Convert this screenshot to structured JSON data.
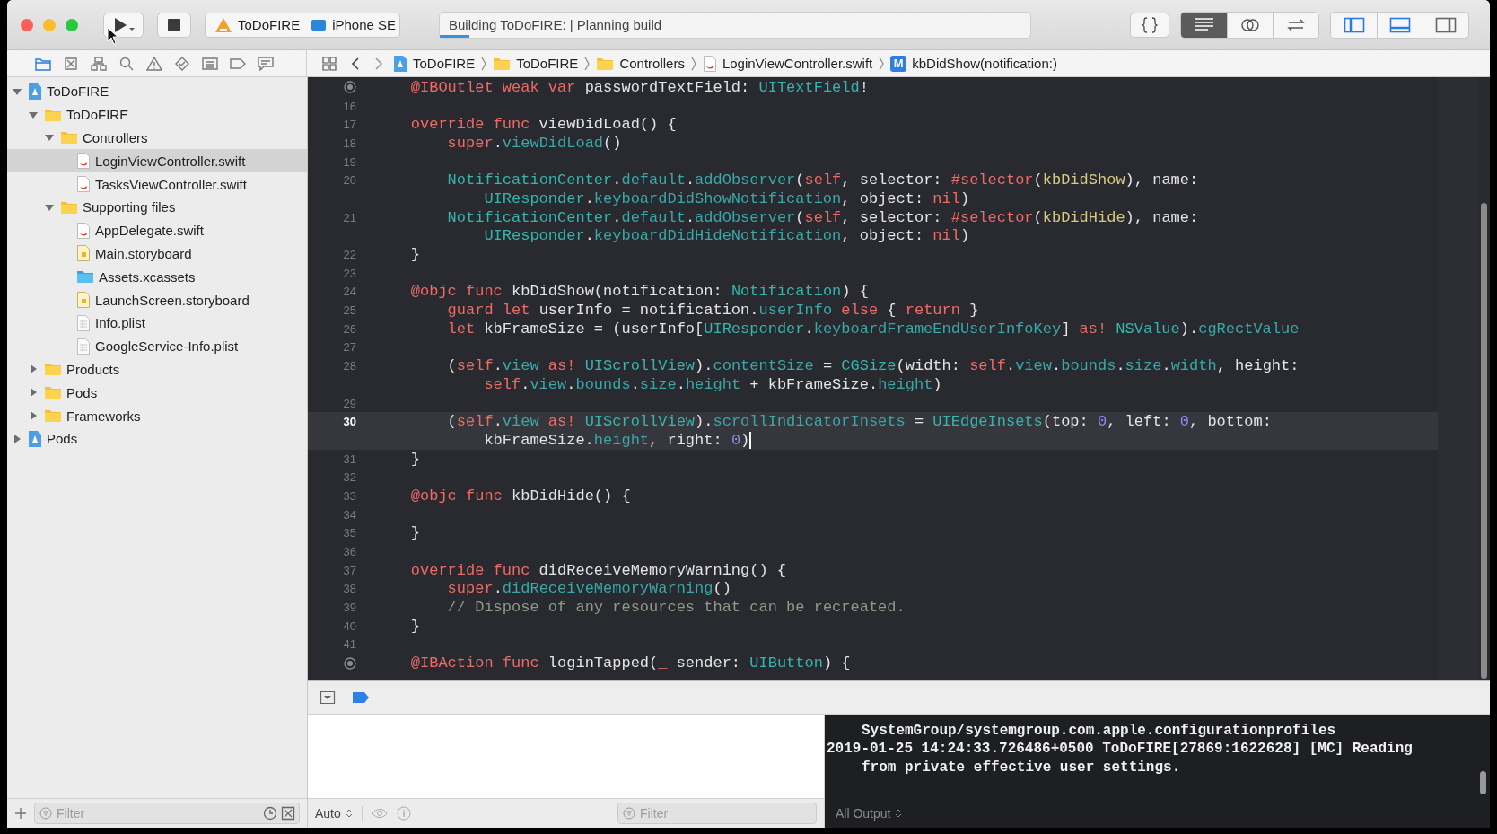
{
  "toolbar": {
    "scheme": "ToDoFIRE",
    "destination": "iPhone SE",
    "activity": {
      "text": "Building ToDoFIRE: | Planning build",
      "level": 0.05
    },
    "editor_modes": [
      {
        "kind": "standard",
        "selected": true
      },
      {
        "kind": "assistant",
        "selected": false
      },
      {
        "kind": "version",
        "selected": false
      }
    ],
    "panels": [
      {
        "kind": "navigator",
        "on": true
      },
      {
        "kind": "debug",
        "on": true
      },
      {
        "kind": "inspector",
        "on": false
      }
    ]
  },
  "navigator": {
    "tabs": [
      {
        "kind": "project",
        "selected": true
      },
      {
        "kind": "source-control",
        "selected": false
      },
      {
        "kind": "symbol",
        "selected": false
      },
      {
        "kind": "find",
        "selected": false
      },
      {
        "kind": "issue",
        "selected": false
      },
      {
        "kind": "test",
        "selected": false
      },
      {
        "kind": "debug",
        "selected": false
      },
      {
        "kind": "breakpoint",
        "selected": false
      },
      {
        "kind": "report",
        "selected": false
      }
    ],
    "tree": [
      {
        "label": "ToDoFIRE",
        "kind": "project",
        "expanded": true,
        "selected": false,
        "children": [
          {
            "label": "ToDoFIRE",
            "kind": "folder",
            "expanded": true,
            "selected": false,
            "children": [
              {
                "label": "Controllers",
                "kind": "folder",
                "expanded": true,
                "selected": false,
                "children": [
                  {
                    "label": "LoginViewController.swift",
                    "kind": "swift",
                    "selected": true
                  },
                  {
                    "label": "TasksViewController.swift",
                    "kind": "swift",
                    "selected": false
                  }
                ]
              },
              {
                "label": "Supporting files",
                "kind": "folder",
                "expanded": true,
                "selected": false,
                "children": [
                  {
                    "label": "AppDelegate.swift",
                    "kind": "swift",
                    "selected": false
                  },
                  {
                    "label": "Main.storyboard",
                    "kind": "storyboard",
                    "selected": false
                  },
                  {
                    "label": "Assets.xcassets",
                    "kind": "assets",
                    "selected": false
                  },
                  {
                    "label": "LaunchScreen.storyboard",
                    "kind": "storyboard",
                    "selected": false
                  },
                  {
                    "label": "Info.plist",
                    "kind": "plist",
                    "selected": false
                  },
                  {
                    "label": "GoogleService-Info.plist",
                    "kind": "plist",
                    "selected": false
                  }
                ]
              }
            ]
          },
          {
            "label": "Products",
            "kind": "folder",
            "expanded": false,
            "selected": false
          },
          {
            "label": "Pods",
            "kind": "folder",
            "expanded": false,
            "selected": false
          },
          {
            "label": "Frameworks",
            "kind": "folder",
            "expanded": false,
            "selected": false
          }
        ]
      },
      {
        "label": "Pods",
        "kind": "project",
        "expanded": false,
        "selected": false
      }
    ],
    "filter": {
      "placeholder": "Filter"
    }
  },
  "jump_bar": [
    {
      "kind": "project",
      "label": "ToDoFIRE"
    },
    {
      "kind": "folder",
      "label": "ToDoFIRE"
    },
    {
      "kind": "folder",
      "label": "Controllers"
    },
    {
      "kind": "swift",
      "label": "LoginViewController.swift"
    },
    {
      "badge": "M",
      "label": "kbDidShow(notification:)"
    }
  ],
  "editor": {
    "lines": [
      {
        "kind": "outlet",
        "current": false,
        "rows": [
          {
            "kind": "member",
            "tokens": [
              {
                "t": "@IBOutlet weak var",
                "kind": "kw"
              },
              {
                "t": " passwordTextField: ",
                "kind": "p"
              },
              {
                "t": "UITextField",
                "kind": "type"
              },
              {
                "t": "!",
                "kind": "p"
              }
            ]
          }
        ]
      },
      {
        "number": "16",
        "current": false
      },
      {
        "number": "17",
        "current": false,
        "rows": [
          {
            "kind": "member",
            "tokens": [
              {
                "t": "override func",
                "kind": "kw"
              },
              {
                "t": " viewDidLoad() {",
                "kind": "p"
              }
            ]
          }
        ]
      },
      {
        "number": "18",
        "current": false,
        "rows": [
          {
            "kind": "body",
            "tokens": [
              {
                "t": "super",
                "kind": "kw"
              },
              {
                "t": ".",
                "kind": "p"
              },
              {
                "t": "viewDidLoad",
                "kind": "mem"
              },
              {
                "t": "()",
                "kind": "p"
              }
            ]
          }
        ]
      },
      {
        "number": "19",
        "current": false
      },
      {
        "number": "20",
        "current": false,
        "rows": [
          {
            "kind": "body",
            "tokens": [
              {
                "t": "NotificationCenter",
                "kind": "type"
              },
              {
                "t": ".",
                "kind": "p"
              },
              {
                "t": "default",
                "kind": "mem"
              },
              {
                "t": ".",
                "kind": "p"
              },
              {
                "t": "addObserver",
                "kind": "mem"
              },
              {
                "t": "(",
                "kind": "p"
              },
              {
                "t": "self",
                "kind": "kw"
              },
              {
                "t": ", selector: ",
                "kind": "p"
              },
              {
                "t": "#selector",
                "kind": "kw"
              },
              {
                "t": "(",
                "kind": "p"
              },
              {
                "t": "kbDidShow",
                "kind": "sel"
              },
              {
                "t": "), name:",
                "kind": "p"
              }
            ]
          },
          {
            "kind": "wrap",
            "tokens": [
              {
                "t": "UIResponder",
                "kind": "type"
              },
              {
                "t": ".",
                "kind": "p"
              },
              {
                "t": "keyboardDidShowNotification",
                "kind": "mem"
              },
              {
                "t": ", object: ",
                "kind": "p"
              },
              {
                "t": "nil",
                "kind": "kw"
              },
              {
                "t": ")",
                "kind": "p"
              }
            ]
          }
        ]
      },
      {
        "number": "21",
        "current": false,
        "rows": [
          {
            "kind": "body",
            "tokens": [
              {
                "t": "NotificationCenter",
                "kind": "type"
              },
              {
                "t": ".",
                "kind": "p"
              },
              {
                "t": "default",
                "kind": "mem"
              },
              {
                "t": ".",
                "kind": "p"
              },
              {
                "t": "addObserver",
                "kind": "mem"
              },
              {
                "t": "(",
                "kind": "p"
              },
              {
                "t": "self",
                "kind": "kw"
              },
              {
                "t": ", selector: ",
                "kind": "p"
              },
              {
                "t": "#selector",
                "kind": "kw"
              },
              {
                "t": "(",
                "kind": "p"
              },
              {
                "t": "kbDidHide",
                "kind": "sel"
              },
              {
                "t": "), name:",
                "kind": "p"
              }
            ]
          },
          {
            "kind": "wrap",
            "tokens": [
              {
                "t": "UIResponder",
                "kind": "type"
              },
              {
                "t": ".",
                "kind": "p"
              },
              {
                "t": "keyboardDidHideNotification",
                "kind": "mem"
              },
              {
                "t": ", object: ",
                "kind": "p"
              },
              {
                "t": "nil",
                "kind": "kw"
              },
              {
                "t": ")",
                "kind": "p"
              }
            ]
          }
        ]
      },
      {
        "number": "22",
        "current": false,
        "rows": [
          {
            "kind": "member",
            "tokens": [
              {
                "t": "}",
                "kind": "p"
              }
            ]
          }
        ]
      },
      {
        "number": "23",
        "current": false
      },
      {
        "number": "24",
        "current": false,
        "rows": [
          {
            "kind": "member",
            "tokens": [
              {
                "t": "@objc func",
                "kind": "kw"
              },
              {
                "t": " kbDidShow(notification: ",
                "kind": "p"
              },
              {
                "t": "Notification",
                "kind": "type"
              },
              {
                "t": ") {",
                "kind": "p"
              }
            ]
          }
        ]
      },
      {
        "number": "25",
        "current": false,
        "rows": [
          {
            "kind": "body",
            "tokens": [
              {
                "t": "guard let",
                "kind": "kw"
              },
              {
                "t": " userInfo = notification.",
                "kind": "p"
              },
              {
                "t": "userInfo",
                "kind": "mem"
              },
              {
                "t": " else",
                "kind": "kw"
              },
              {
                "t": " { ",
                "kind": "p"
              },
              {
                "t": "return",
                "kind": "kw"
              },
              {
                "t": " }",
                "kind": "p"
              }
            ]
          }
        ]
      },
      {
        "number": "26",
        "current": false,
        "rows": [
          {
            "kind": "body",
            "tokens": [
              {
                "t": "let",
                "kind": "kw"
              },
              {
                "t": " kbFrameSize = (userInfo[",
                "kind": "p"
              },
              {
                "t": "UIResponder",
                "kind": "type"
              },
              {
                "t": ".",
                "kind": "p"
              },
              {
                "t": "keyboardFrameEndUserInfoKey",
                "kind": "mem"
              },
              {
                "t": "] ",
                "kind": "p"
              },
              {
                "t": "as!",
                "kind": "kw"
              },
              {
                "t": " NSValue",
                "kind": "type"
              },
              {
                "t": ").",
                "kind": "p"
              },
              {
                "t": "cgRectValue",
                "kind": "mem"
              }
            ]
          }
        ]
      },
      {
        "number": "27",
        "current": false
      },
      {
        "number": "28",
        "current": false,
        "rows": [
          {
            "kind": "body",
            "tokens": [
              {
                "t": "(",
                "kind": "p"
              },
              {
                "t": "self",
                "kind": "kw"
              },
              {
                "t": ".",
                "kind": "p"
              },
              {
                "t": "view",
                "kind": "mem"
              },
              {
                "t": " as!",
                "kind": "kw"
              },
              {
                "t": " UIScrollView",
                "kind": "type"
              },
              {
                "t": ").",
                "kind": "p"
              },
              {
                "t": "contentSize",
                "kind": "mem"
              },
              {
                "t": " = ",
                "kind": "p"
              },
              {
                "t": "CGSize",
                "kind": "type"
              },
              {
                "t": "(width: ",
                "kind": "p"
              },
              {
                "t": "self",
                "kind": "kw"
              },
              {
                "t": ".",
                "kind": "p"
              },
              {
                "t": "view",
                "kind": "mem"
              },
              {
                "t": ".",
                "kind": "p"
              },
              {
                "t": "bounds",
                "kind": "mem"
              },
              {
                "t": ".",
                "kind": "p"
              },
              {
                "t": "size",
                "kind": "mem"
              },
              {
                "t": ".",
                "kind": "p"
              },
              {
                "t": "width",
                "kind": "mem"
              },
              {
                "t": ", height:",
                "kind": "p"
              }
            ]
          },
          {
            "kind": "wrap",
            "tokens": [
              {
                "t": "self",
                "kind": "kw"
              },
              {
                "t": ".",
                "kind": "p"
              },
              {
                "t": "view",
                "kind": "mem"
              },
              {
                "t": ".",
                "kind": "p"
              },
              {
                "t": "bounds",
                "kind": "mem"
              },
              {
                "t": ".",
                "kind": "p"
              },
              {
                "t": "size",
                "kind": "mem"
              },
              {
                "t": ".",
                "kind": "p"
              },
              {
                "t": "height",
                "kind": "mem"
              },
              {
                "t": " + kbFrameSize.",
                "kind": "p"
              },
              {
                "t": "height",
                "kind": "mem"
              },
              {
                "t": ")",
                "kind": "p"
              }
            ]
          }
        ]
      },
      {
        "number": "29",
        "current": false
      },
      {
        "number": "30",
        "current": true,
        "rows": [
          {
            "kind": "body",
            "tokens": [
              {
                "t": "(",
                "kind": "p"
              },
              {
                "t": "self",
                "kind": "kw"
              },
              {
                "t": ".",
                "kind": "p"
              },
              {
                "t": "view",
                "kind": "mem"
              },
              {
                "t": " as!",
                "kind": "kw"
              },
              {
                "t": " UIScrollView",
                "kind": "type"
              },
              {
                "t": ").",
                "kind": "p"
              },
              {
                "t": "scrollIndicatorInsets",
                "kind": "mem"
              },
              {
                "t": " = ",
                "kind": "p"
              },
              {
                "t": "UIEdgeInsets",
                "kind": "type"
              },
              {
                "t": "(top: ",
                "kind": "p"
              },
              {
                "t": "0",
                "kind": "num"
              },
              {
                "t": ", left: ",
                "kind": "p"
              },
              {
                "t": "0",
                "kind": "num"
              },
              {
                "t": ", bottom:",
                "kind": "p"
              }
            ]
          },
          {
            "kind": "wrap",
            "tokens": [
              {
                "t": "kbFrameSize.",
                "kind": "p"
              },
              {
                "t": "height",
                "kind": "mem"
              },
              {
                "t": ", right: ",
                "kind": "p"
              },
              {
                "t": "0",
                "kind": "num"
              },
              {
                "t": ")",
                "kind": "p"
              }
            ]
          }
        ]
      },
      {
        "number": "31",
        "current": false,
        "rows": [
          {
            "kind": "member",
            "tokens": [
              {
                "t": "}",
                "kind": "p"
              }
            ]
          }
        ]
      },
      {
        "number": "32",
        "current": false
      },
      {
        "number": "33",
        "current": false,
        "rows": [
          {
            "kind": "member",
            "tokens": [
              {
                "t": "@objc func",
                "kind": "kw"
              },
              {
                "t": " kbDidHide() {",
                "kind": "p"
              }
            ]
          }
        ]
      },
      {
        "number": "34",
        "current": false
      },
      {
        "number": "35",
        "current": false,
        "rows": [
          {
            "kind": "member",
            "tokens": [
              {
                "t": "}",
                "kind": "p"
              }
            ]
          }
        ]
      },
      {
        "number": "36",
        "current": false
      },
      {
        "number": "37",
        "current": false,
        "rows": [
          {
            "kind": "member",
            "tokens": [
              {
                "t": "override func",
                "kind": "kw"
              },
              {
                "t": " didReceiveMemoryWarning() {",
                "kind": "p"
              }
            ]
          }
        ]
      },
      {
        "number": "38",
        "current": false,
        "rows": [
          {
            "kind": "body",
            "tokens": [
              {
                "t": "super",
                "kind": "kw"
              },
              {
                "t": ".",
                "kind": "p"
              },
              {
                "t": "didReceiveMemoryWarning",
                "kind": "mem"
              },
              {
                "t": "()",
                "kind": "p"
              }
            ]
          }
        ]
      },
      {
        "number": "39",
        "current": false,
        "rows": [
          {
            "kind": "body",
            "tokens": [
              {
                "t": "// Dispose of any resources that can be recreated.",
                "kind": "cmt"
              }
            ]
          }
        ]
      },
      {
        "number": "40",
        "current": false,
        "rows": [
          {
            "kind": "member",
            "tokens": [
              {
                "t": "}",
                "kind": "p"
              }
            ]
          }
        ]
      },
      {
        "number": "41",
        "current": false
      },
      {
        "kind": "outlet",
        "current": false,
        "rows": [
          {
            "kind": "member",
            "tokens": [
              {
                "t": "@IBAction func",
                "kind": "kw"
              },
              {
                "t": " loginTapped(",
                "kind": "p"
              },
              {
                "t": "_",
                "kind": "kw"
              },
              {
                "t": " sender: ",
                "kind": "p"
              },
              {
                "t": "UIButton",
                "kind": "type"
              },
              {
                "t": ") {",
                "kind": "p"
              }
            ]
          }
        ]
      }
    ]
  },
  "debug": {
    "scope": "Auto",
    "filter": {
      "placeholder": "Filter"
    },
    "console": [
      {
        "kind": "tail",
        "lines": [
          "SystemGroup/systemgroup.com.apple.configurationprofiles"
        ]
      },
      {
        "kind": "message",
        "lines": [
          "2019-01-25 14:24:33.726486+0500 ToDoFIRE[27869:1622628] [MC] Reading",
          "from private effective user settings."
        ]
      }
    ],
    "output": "All Output"
  }
}
